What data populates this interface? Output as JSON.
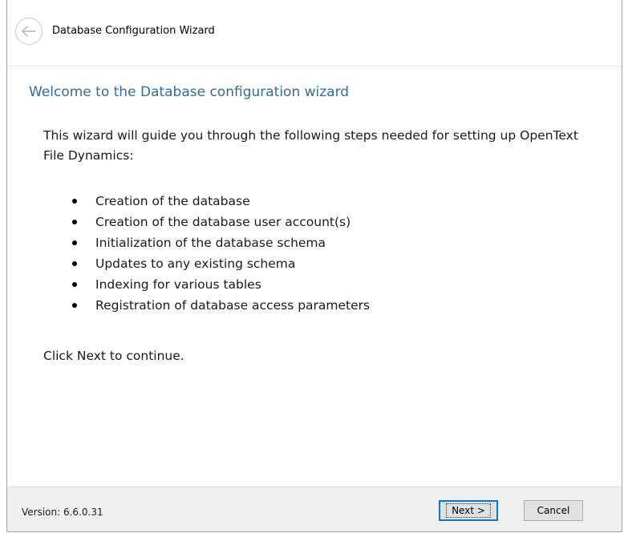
{
  "window": {
    "title": "Database Configuration Wizard"
  },
  "page": {
    "heading": "Welcome to the Database configuration wizard",
    "intro": "This wizard will guide you through the following steps needed for setting up OpenText File Dynamics:",
    "steps": [
      "Creation of the database",
      "Creation of the database user account(s)",
      "Initialization of the database schema",
      "Updates to any existing schema",
      "Indexing for various tables",
      "Registration of database access parameters"
    ],
    "continue_text": "Click Next to continue."
  },
  "footer": {
    "version": "Version: 6.6.0.31",
    "next_label": "Next >",
    "cancel_label": "Cancel"
  },
  "colors": {
    "heading": "#2e6da4",
    "focus_border": "#0078d7",
    "footer_bg": "#f0f0f0"
  },
  "icons": {
    "back": "back-arrow-icon"
  }
}
